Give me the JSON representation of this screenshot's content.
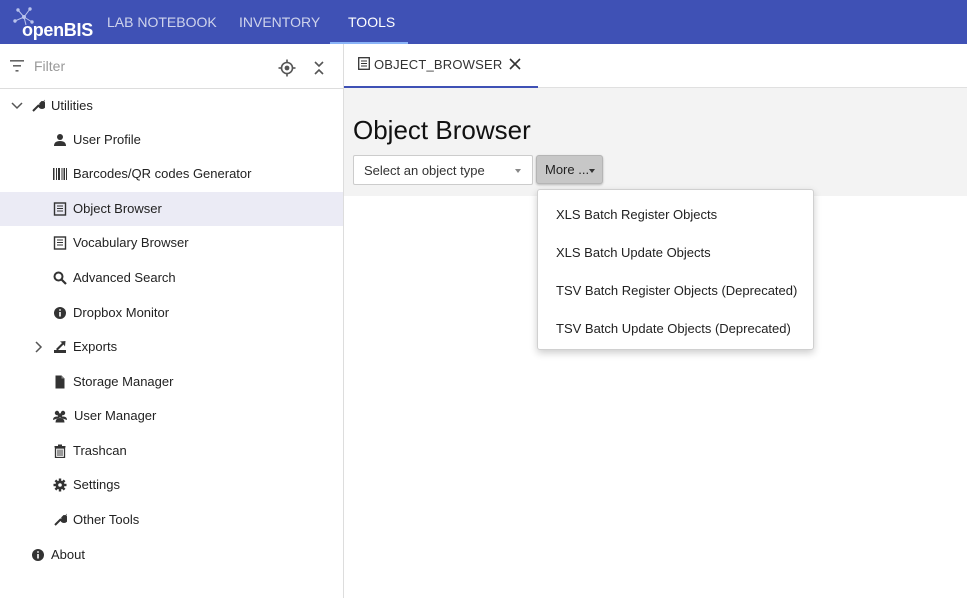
{
  "app": {
    "logo_text": "openBIS",
    "nav_tabs": [
      {
        "label": "LAB NOTEBOOK",
        "active": false
      },
      {
        "label": "INVENTORY",
        "active": false
      },
      {
        "label": "TOOLS",
        "active": true
      }
    ],
    "colors": {
      "header": "#3f51b5",
      "selected_row": "#ebebf5",
      "tab_underline": "#3f51b5"
    }
  },
  "sidebar": {
    "filter": {
      "placeholder": "Filter",
      "value": ""
    },
    "tree": [
      {
        "label": "Utilities",
        "icon": "wrench-icon",
        "expanded": true
      },
      {
        "label": "User Profile",
        "icon": "person-icon"
      },
      {
        "label": "Barcodes/QR codes Generator",
        "icon": "barcode-icon"
      },
      {
        "label": "Object Browser",
        "icon": "table-icon",
        "selected": true
      },
      {
        "label": "Vocabulary Browser",
        "icon": "table-icon"
      },
      {
        "label": "Advanced Search",
        "icon": "search-icon"
      },
      {
        "label": "Dropbox Monitor",
        "icon": "info-icon"
      },
      {
        "label": "Exports",
        "icon": "export-icon",
        "expanded": false
      },
      {
        "label": "Storage Manager",
        "icon": "file-icon"
      },
      {
        "label": "User Manager",
        "icon": "users-icon"
      },
      {
        "label": "Trashcan",
        "icon": "trash-icon"
      },
      {
        "label": "Settings",
        "icon": "gear-icon"
      },
      {
        "label": "Other Tools",
        "icon": "wrench-icon"
      },
      {
        "label": "About",
        "icon": "info-icon"
      }
    ]
  },
  "main": {
    "tab": {
      "label": "OBJECT_BROWSER"
    },
    "title": "Object Browser",
    "type_select": {
      "label": "Select an object type"
    },
    "more_button": {
      "label": "More ..."
    },
    "menu": [
      {
        "label": "XLS Batch Register Objects"
      },
      {
        "label": "XLS Batch Update Objects"
      },
      {
        "label": "TSV Batch Register Objects (Deprecated)"
      },
      {
        "label": "TSV Batch Update Objects (Deprecated)"
      }
    ]
  }
}
